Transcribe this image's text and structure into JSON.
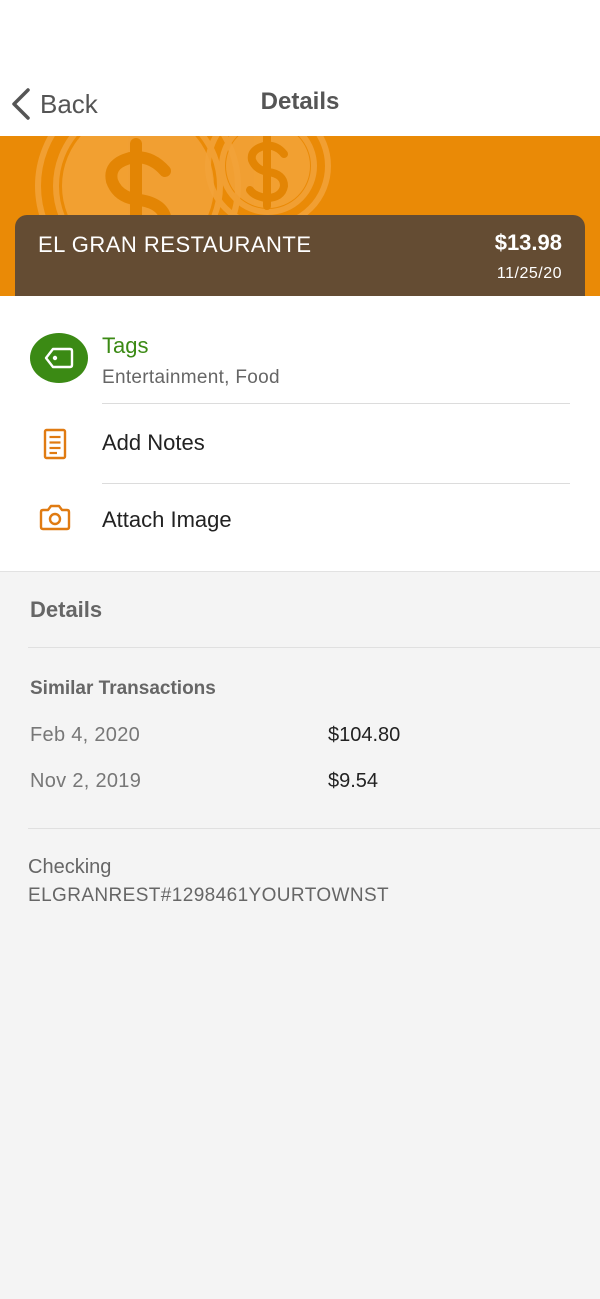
{
  "header": {
    "back_label": "Back",
    "title": "Details"
  },
  "transaction": {
    "merchant": "EL GRAN RESTAURANTE",
    "amount": "$13.98",
    "date": "11/25/20"
  },
  "actions": {
    "tags": {
      "label": "Tags",
      "values": "Entertainment, Food"
    },
    "add_notes_label": "Add Notes",
    "attach_image_label": "Attach Image"
  },
  "details": {
    "section_title": "Details",
    "similar_title": "Similar Transactions",
    "similar": [
      {
        "date": "Feb 4, 2020",
        "amount": "$104.80"
      },
      {
        "date": "Nov 2, 2019",
        "amount": "$9.54"
      }
    ],
    "account_type": "Checking",
    "description": "ELGRANREST#1298461YOURTOWNST"
  },
  "colors": {
    "banner": "#ea8a06",
    "card": "#644c33",
    "tag_green": "#3b8a14",
    "icon_orange": "#e07b12"
  },
  "icons": {
    "back": "chevron-left-icon",
    "tag": "tag-icon",
    "notes": "document-icon",
    "image": "camera-icon",
    "banner": "coins-icon"
  }
}
